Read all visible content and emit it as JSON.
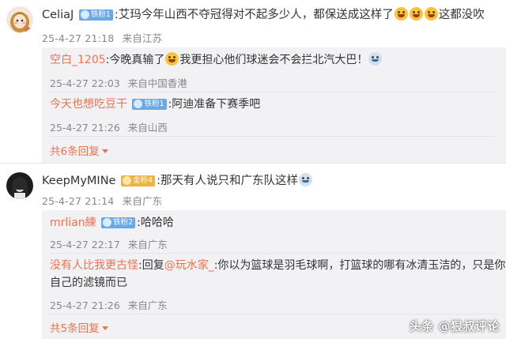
{
  "comments": [
    {
      "username": "CeliaJ",
      "badge": "铁粉1",
      "text_before": ":艾玛今年山西不夺冠得对不起多少人，都保送成这样了",
      "text_after": "这都没吹",
      "emojis": [
        "laughing-emoji",
        "laughing-emoji",
        "laughing-emoji"
      ],
      "date": "25-4-27 21:18",
      "location": "来自江苏",
      "replies": [
        {
          "username": "空白_1205",
          "sep": ":",
          "text_before": "今晚真输了",
          "text_after": "我更担心他们球迷会不会拦北汽大巴！",
          "date": "25-4-27 22:03",
          "location": "来自中国香港"
        },
        {
          "username": "今天也想吃豆干",
          "badge": "铁粉1",
          "sep": ":",
          "text": "阿迪准备下赛季吧",
          "date": "25-4-27 21:26",
          "location": "来自山西"
        }
      ],
      "more_replies": "共6条回复"
    },
    {
      "username": "KeepMyMINe",
      "badge": "金粉4",
      "text": ":那天有人说只和广东队这样",
      "date": "25-4-27 21:14",
      "location": "来自广东",
      "replies": [
        {
          "username": "mrlian練",
          "badge": "铁粉2",
          "sep": ":",
          "text": "哈哈哈",
          "date": "25-4-27 22:17",
          "location": "来自广东"
        },
        {
          "username": "没有人比我更古怪",
          "sep": ":",
          "reply_word": "回复",
          "mention": "@玩水家_",
          "text_line1": ":你以为篮球是羽毛球啊，打篮球的哪有冰清玉洁的，只是你",
          "text_line2": "自己的滤镜而已",
          "date": "25-4-27 21:26",
          "location": "来自广东"
        }
      ],
      "more_replies": "共5条回复"
    }
  ],
  "watermark": "头条 @狠叔评论",
  "colors": {
    "accent": "#eb7350",
    "meta": "#888888",
    "reply_bg": "#f2f2f5"
  }
}
